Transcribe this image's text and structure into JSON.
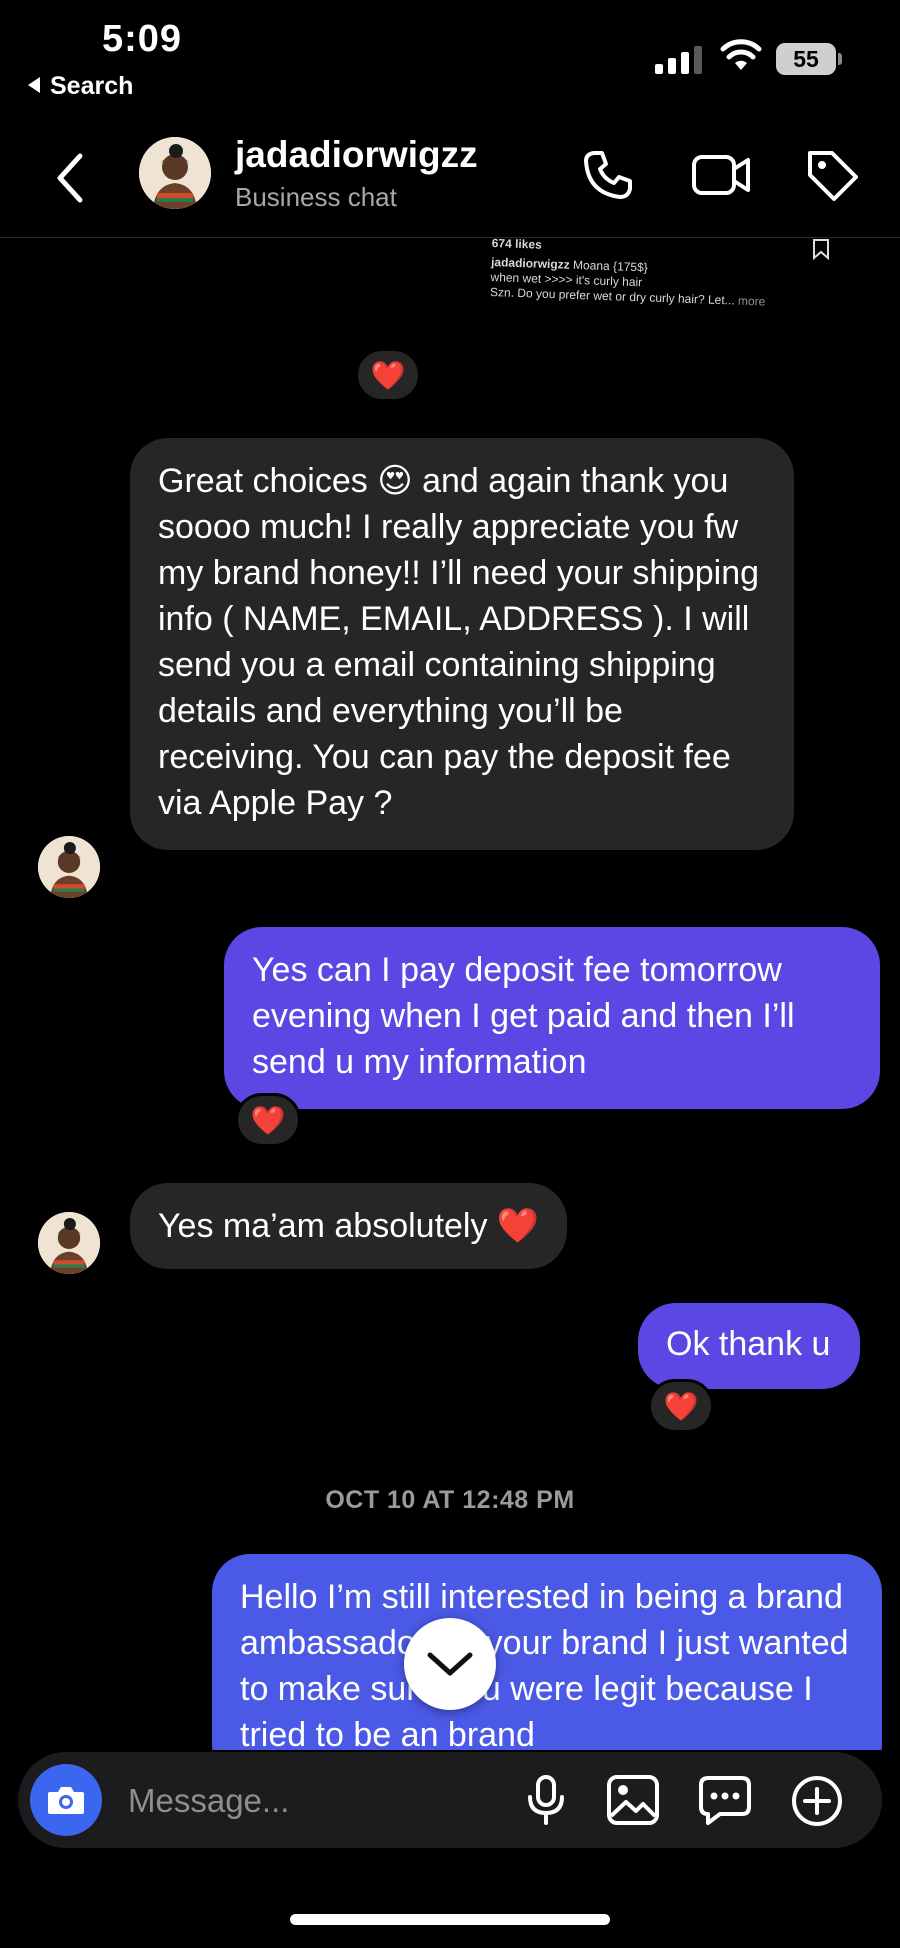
{
  "status_bar": {
    "time": "5:09",
    "back_app": "Search",
    "battery": "55"
  },
  "header": {
    "contact_name": "jadadiorwigzz",
    "subtitle": "Business chat",
    "icons": [
      "chevron-left-icon",
      "phone-icon",
      "video-camera-icon",
      "tag-icon"
    ]
  },
  "shared_post": {
    "likes": "674 likes",
    "username": "jadadiorwigzz",
    "caption_line1": "Moana {175$}",
    "caption_line2": "when wet >>>> it's curly hair",
    "caption_line3": "Szn. Do you prefer wet or dry curly hair? Let...",
    "more": "more"
  },
  "messages": [
    {
      "direction": "received",
      "reaction": "❤️",
      "text": "Great choices 😍 and again thank you soooo much! I really appreciate you fw my brand honey!! I’ll need your shipping info ( NAME, EMAIL, ADDRESS ). I will send you a email containing shipping details and everything you’ll be receiving. You can pay the deposit fee via Apple Pay ?"
    },
    {
      "direction": "sent",
      "reaction": "❤️",
      "text": "Yes can I pay deposit fee tomorrow evening when I get paid and then I’ll send u my information"
    },
    {
      "direction": "received",
      "text": "Yes ma’am absolutely ❤️"
    },
    {
      "direction": "sent",
      "reaction": "❤️",
      "text": "Ok thank u"
    },
    {
      "direction": "sent",
      "text": "Hello I’m still interested in being a brand ambassador for your brand I just wanted to make sure you were legit because I tried to be an brand"
    }
  ],
  "post_reaction": "❤️",
  "timestamp": "OCT 10 AT 12:48 PM",
  "composer": {
    "placeholder": "Message...",
    "icons": [
      "camera-icon",
      "microphone-icon",
      "gallery-icon",
      "sticker-chat-icon",
      "plus-circle-icon"
    ]
  },
  "colors": {
    "background": "#000000",
    "received_bubble": "#262626",
    "sent_bubble": "#5b47e3",
    "camera_button": "#3a66f0"
  }
}
